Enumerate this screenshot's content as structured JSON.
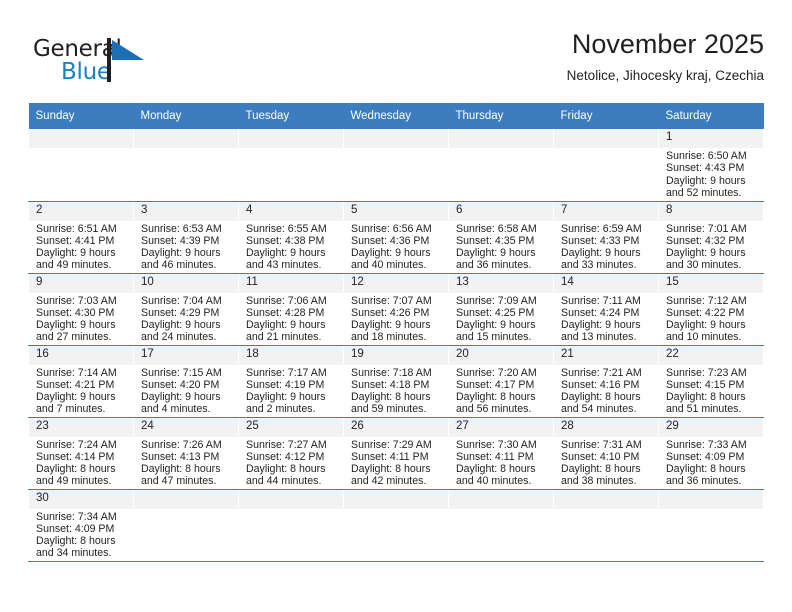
{
  "brand": {
    "name_top": "General",
    "name_bottom": "Blue",
    "flag_icon": "blue-flag-triangle",
    "color_primary": "#1c7ec4",
    "color_text": "#231f20"
  },
  "header": {
    "title": "November 2025",
    "subtitle": "Netolice, Jihocesky kraj, Czechia"
  },
  "theme": {
    "header_bg": "#3b7dbf",
    "header_text": "#ffffff",
    "daynum_bg": "#f2f2f2",
    "cell_border": "#3b7dbf"
  },
  "weekday_headers": [
    "Sunday",
    "Monday",
    "Tuesday",
    "Wednesday",
    "Thursday",
    "Friday",
    "Saturday"
  ],
  "weeks": [
    [
      {
        "day": "",
        "empty": true,
        "sunrise": "",
        "sunset": "",
        "daylight1": "",
        "daylight2": ""
      },
      {
        "day": "",
        "empty": true,
        "sunrise": "",
        "sunset": "",
        "daylight1": "",
        "daylight2": ""
      },
      {
        "day": "",
        "empty": true,
        "sunrise": "",
        "sunset": "",
        "daylight1": "",
        "daylight2": ""
      },
      {
        "day": "",
        "empty": true,
        "sunrise": "",
        "sunset": "",
        "daylight1": "",
        "daylight2": ""
      },
      {
        "day": "",
        "empty": true,
        "sunrise": "",
        "sunset": "",
        "daylight1": "",
        "daylight2": ""
      },
      {
        "day": "",
        "empty": true,
        "sunrise": "",
        "sunset": "",
        "daylight1": "",
        "daylight2": ""
      },
      {
        "day": "1",
        "empty": false,
        "sunrise": "Sunrise: 6:50 AM",
        "sunset": "Sunset: 4:43 PM",
        "daylight1": "Daylight: 9 hours",
        "daylight2": "and 52 minutes."
      }
    ],
    [
      {
        "day": "2",
        "empty": false,
        "sunrise": "Sunrise: 6:51 AM",
        "sunset": "Sunset: 4:41 PM",
        "daylight1": "Daylight: 9 hours",
        "daylight2": "and 49 minutes."
      },
      {
        "day": "3",
        "empty": false,
        "sunrise": "Sunrise: 6:53 AM",
        "sunset": "Sunset: 4:39 PM",
        "daylight1": "Daylight: 9 hours",
        "daylight2": "and 46 minutes."
      },
      {
        "day": "4",
        "empty": false,
        "sunrise": "Sunrise: 6:55 AM",
        "sunset": "Sunset: 4:38 PM",
        "daylight1": "Daylight: 9 hours",
        "daylight2": "and 43 minutes."
      },
      {
        "day": "5",
        "empty": false,
        "sunrise": "Sunrise: 6:56 AM",
        "sunset": "Sunset: 4:36 PM",
        "daylight1": "Daylight: 9 hours",
        "daylight2": "and 40 minutes."
      },
      {
        "day": "6",
        "empty": false,
        "sunrise": "Sunrise: 6:58 AM",
        "sunset": "Sunset: 4:35 PM",
        "daylight1": "Daylight: 9 hours",
        "daylight2": "and 36 minutes."
      },
      {
        "day": "7",
        "empty": false,
        "sunrise": "Sunrise: 6:59 AM",
        "sunset": "Sunset: 4:33 PM",
        "daylight1": "Daylight: 9 hours",
        "daylight2": "and 33 minutes."
      },
      {
        "day": "8",
        "empty": false,
        "sunrise": "Sunrise: 7:01 AM",
        "sunset": "Sunset: 4:32 PM",
        "daylight1": "Daylight: 9 hours",
        "daylight2": "and 30 minutes."
      }
    ],
    [
      {
        "day": "9",
        "empty": false,
        "sunrise": "Sunrise: 7:03 AM",
        "sunset": "Sunset: 4:30 PM",
        "daylight1": "Daylight: 9 hours",
        "daylight2": "and 27 minutes."
      },
      {
        "day": "10",
        "empty": false,
        "sunrise": "Sunrise: 7:04 AM",
        "sunset": "Sunset: 4:29 PM",
        "daylight1": "Daylight: 9 hours",
        "daylight2": "and 24 minutes."
      },
      {
        "day": "11",
        "empty": false,
        "sunrise": "Sunrise: 7:06 AM",
        "sunset": "Sunset: 4:28 PM",
        "daylight1": "Daylight: 9 hours",
        "daylight2": "and 21 minutes."
      },
      {
        "day": "12",
        "empty": false,
        "sunrise": "Sunrise: 7:07 AM",
        "sunset": "Sunset: 4:26 PM",
        "daylight1": "Daylight: 9 hours",
        "daylight2": "and 18 minutes."
      },
      {
        "day": "13",
        "empty": false,
        "sunrise": "Sunrise: 7:09 AM",
        "sunset": "Sunset: 4:25 PM",
        "daylight1": "Daylight: 9 hours",
        "daylight2": "and 15 minutes."
      },
      {
        "day": "14",
        "empty": false,
        "sunrise": "Sunrise: 7:11 AM",
        "sunset": "Sunset: 4:24 PM",
        "daylight1": "Daylight: 9 hours",
        "daylight2": "and 13 minutes."
      },
      {
        "day": "15",
        "empty": false,
        "sunrise": "Sunrise: 7:12 AM",
        "sunset": "Sunset: 4:22 PM",
        "daylight1": "Daylight: 9 hours",
        "daylight2": "and 10 minutes."
      }
    ],
    [
      {
        "day": "16",
        "empty": false,
        "sunrise": "Sunrise: 7:14 AM",
        "sunset": "Sunset: 4:21 PM",
        "daylight1": "Daylight: 9 hours",
        "daylight2": "and 7 minutes."
      },
      {
        "day": "17",
        "empty": false,
        "sunrise": "Sunrise: 7:15 AM",
        "sunset": "Sunset: 4:20 PM",
        "daylight1": "Daylight: 9 hours",
        "daylight2": "and 4 minutes."
      },
      {
        "day": "18",
        "empty": false,
        "sunrise": "Sunrise: 7:17 AM",
        "sunset": "Sunset: 4:19 PM",
        "daylight1": "Daylight: 9 hours",
        "daylight2": "and 2 minutes."
      },
      {
        "day": "19",
        "empty": false,
        "sunrise": "Sunrise: 7:18 AM",
        "sunset": "Sunset: 4:18 PM",
        "daylight1": "Daylight: 8 hours",
        "daylight2": "and 59 minutes."
      },
      {
        "day": "20",
        "empty": false,
        "sunrise": "Sunrise: 7:20 AM",
        "sunset": "Sunset: 4:17 PM",
        "daylight1": "Daylight: 8 hours",
        "daylight2": "and 56 minutes."
      },
      {
        "day": "21",
        "empty": false,
        "sunrise": "Sunrise: 7:21 AM",
        "sunset": "Sunset: 4:16 PM",
        "daylight1": "Daylight: 8 hours",
        "daylight2": "and 54 minutes."
      },
      {
        "day": "22",
        "empty": false,
        "sunrise": "Sunrise: 7:23 AM",
        "sunset": "Sunset: 4:15 PM",
        "daylight1": "Daylight: 8 hours",
        "daylight2": "and 51 minutes."
      }
    ],
    [
      {
        "day": "23",
        "empty": false,
        "sunrise": "Sunrise: 7:24 AM",
        "sunset": "Sunset: 4:14 PM",
        "daylight1": "Daylight: 8 hours",
        "daylight2": "and 49 minutes."
      },
      {
        "day": "24",
        "empty": false,
        "sunrise": "Sunrise: 7:26 AM",
        "sunset": "Sunset: 4:13 PM",
        "daylight1": "Daylight: 8 hours",
        "daylight2": "and 47 minutes."
      },
      {
        "day": "25",
        "empty": false,
        "sunrise": "Sunrise: 7:27 AM",
        "sunset": "Sunset: 4:12 PM",
        "daylight1": "Daylight: 8 hours",
        "daylight2": "and 44 minutes."
      },
      {
        "day": "26",
        "empty": false,
        "sunrise": "Sunrise: 7:29 AM",
        "sunset": "Sunset: 4:11 PM",
        "daylight1": "Daylight: 8 hours",
        "daylight2": "and 42 minutes."
      },
      {
        "day": "27",
        "empty": false,
        "sunrise": "Sunrise: 7:30 AM",
        "sunset": "Sunset: 4:11 PM",
        "daylight1": "Daylight: 8 hours",
        "daylight2": "and 40 minutes."
      },
      {
        "day": "28",
        "empty": false,
        "sunrise": "Sunrise: 7:31 AM",
        "sunset": "Sunset: 4:10 PM",
        "daylight1": "Daylight: 8 hours",
        "daylight2": "and 38 minutes."
      },
      {
        "day": "29",
        "empty": false,
        "sunrise": "Sunrise: 7:33 AM",
        "sunset": "Sunset: 4:09 PM",
        "daylight1": "Daylight: 8 hours",
        "daylight2": "and 36 minutes."
      }
    ],
    [
      {
        "day": "30",
        "empty": false,
        "sunrise": "Sunrise: 7:34 AM",
        "sunset": "Sunset: 4:09 PM",
        "daylight1": "Daylight: 8 hours",
        "daylight2": "and 34 minutes."
      },
      {
        "day": "",
        "empty": true,
        "sunrise": "",
        "sunset": "",
        "daylight1": "",
        "daylight2": ""
      },
      {
        "day": "",
        "empty": true,
        "sunrise": "",
        "sunset": "",
        "daylight1": "",
        "daylight2": ""
      },
      {
        "day": "",
        "empty": true,
        "sunrise": "",
        "sunset": "",
        "daylight1": "",
        "daylight2": ""
      },
      {
        "day": "",
        "empty": true,
        "sunrise": "",
        "sunset": "",
        "daylight1": "",
        "daylight2": ""
      },
      {
        "day": "",
        "empty": true,
        "sunrise": "",
        "sunset": "",
        "daylight1": "",
        "daylight2": ""
      },
      {
        "day": "",
        "empty": true,
        "sunrise": "",
        "sunset": "",
        "daylight1": "",
        "daylight2": ""
      }
    ]
  ]
}
